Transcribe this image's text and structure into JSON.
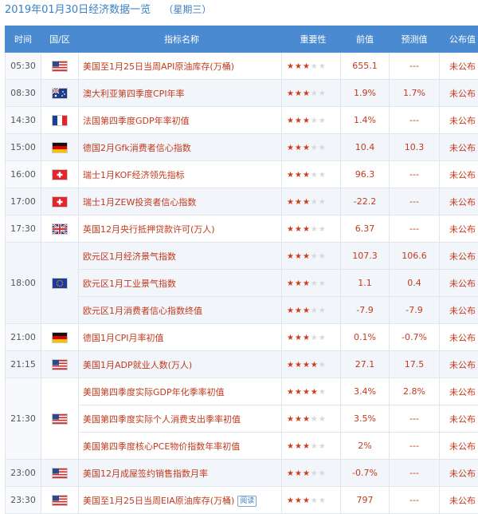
{
  "header": {
    "date_title": "2019年01月30日经济数据一览",
    "weekday": "（星期三）"
  },
  "columns": [
    "时间",
    "国/区",
    "指标名称",
    "重要性",
    "前值",
    "预测值",
    "公布值"
  ],
  "read_label": "阅读",
  "groups": [
    {
      "time": "05:30",
      "flag": "us",
      "rows": [
        {
          "name": "美国至1月25日当周API原油库存(万桶)",
          "stars": 3,
          "prev": "655.1",
          "forecast": "---",
          "actual": "未公布"
        }
      ]
    },
    {
      "time": "08:30",
      "flag": "au",
      "rows": [
        {
          "name": "澳大利亚第四季度CPI年率",
          "stars": 3,
          "prev": "1.9%",
          "forecast": "1.7%",
          "actual": "未公布"
        }
      ]
    },
    {
      "time": "14:30",
      "flag": "fr",
      "rows": [
        {
          "name": "法国第四季度GDP年率初值",
          "stars": 3,
          "prev": "1.4%",
          "forecast": "---",
          "actual": "未公布"
        }
      ]
    },
    {
      "time": "15:00",
      "flag": "de",
      "rows": [
        {
          "name": "德国2月Gfk消费者信心指数",
          "stars": 3,
          "prev": "10.4",
          "forecast": "10.3",
          "actual": "未公布"
        }
      ]
    },
    {
      "time": "16:00",
      "flag": "ch",
      "rows": [
        {
          "name": "瑞士1月KOF经济领先指标",
          "stars": 3,
          "prev": "96.3",
          "forecast": "---",
          "actual": "未公布"
        }
      ]
    },
    {
      "time": "17:00",
      "flag": "ch",
      "rows": [
        {
          "name": "瑞士1月ZEW投资者信心指数",
          "stars": 3,
          "prev": "-22.2",
          "forecast": "---",
          "actual": "未公布"
        }
      ]
    },
    {
      "time": "17:30",
      "flag": "gb",
      "rows": [
        {
          "name": "英国12月央行抵押贷款许可(万人)",
          "stars": 3,
          "prev": "6.37",
          "forecast": "---",
          "actual": "未公布"
        }
      ]
    },
    {
      "time": "18:00",
      "flag": "eu",
      "rows": [
        {
          "name": "欧元区1月经济景气指数",
          "stars": 3,
          "prev": "107.3",
          "forecast": "106.6",
          "actual": "未公布"
        },
        {
          "name": "欧元区1月工业景气指数",
          "stars": 3,
          "prev": "1.1",
          "forecast": "0.4",
          "actual": "未公布"
        },
        {
          "name": "欧元区1月消费者信心指数终值",
          "stars": 3,
          "prev": "-7.9",
          "forecast": "-7.9",
          "actual": "未公布"
        }
      ]
    },
    {
      "time": "21:00",
      "flag": "de",
      "rows": [
        {
          "name": "德国1月CPI月率初值",
          "stars": 3,
          "prev": "0.1%",
          "forecast": "-0.7%",
          "actual": "未公布"
        }
      ]
    },
    {
      "time": "21:15",
      "flag": "us",
      "rows": [
        {
          "name": "美国1月ADP就业人数(万人)",
          "stars": 4,
          "prev": "27.1",
          "forecast": "17.5",
          "actual": "未公布"
        }
      ]
    },
    {
      "time": "21:30",
      "flag": "us",
      "rows": [
        {
          "name": "美国第四季度实际GDP年化季率初值",
          "stars": 4,
          "prev": "3.4%",
          "forecast": "2.8%",
          "actual": "未公布"
        },
        {
          "name": "美国第四季度实际个人消费支出季率初值",
          "stars": 3,
          "prev": "3.5%",
          "forecast": "---",
          "actual": "未公布"
        },
        {
          "name": "美国第四季度核心PCE物价指数年率初值",
          "stars": 3,
          "prev": "2%",
          "forecast": "---",
          "actual": "未公布"
        }
      ]
    },
    {
      "time": "23:00",
      "flag": "us",
      "rows": [
        {
          "name": "美国12月成屋签约销售指数月率",
          "stars": 3,
          "prev": "-0.7%",
          "forecast": "---",
          "actual": "未公布"
        }
      ]
    },
    {
      "time": "23:30",
      "flag": "us",
      "rows": [
        {
          "name": "美国至1月25日当周EIA原油库存(万桶)",
          "stars": 3,
          "prev": "797",
          "forecast": "---",
          "actual": "未公布",
          "read": true
        }
      ]
    }
  ]
}
